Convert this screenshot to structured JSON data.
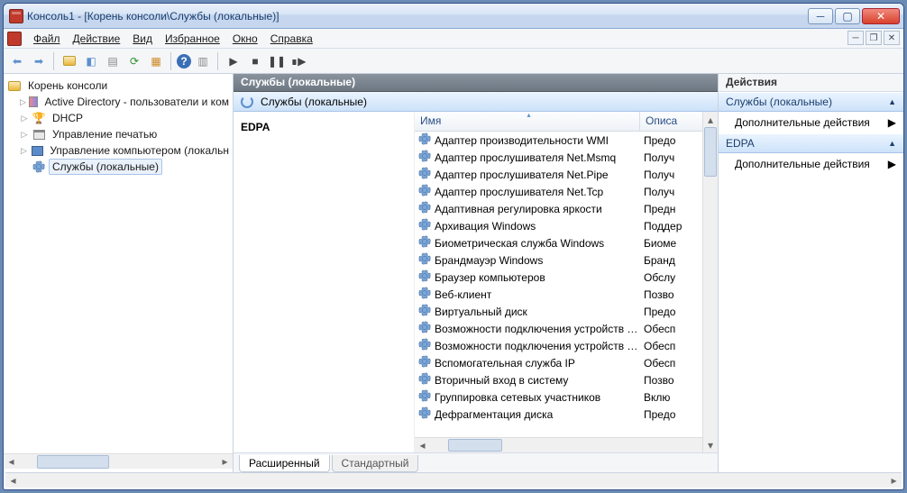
{
  "window": {
    "title": "Консоль1 - [Корень консоли\\Службы (локальные)]"
  },
  "menu": {
    "file": "Файл",
    "action": "Действие",
    "view": "Вид",
    "favorites": "Избранное",
    "window": "Окно",
    "help": "Справка"
  },
  "tree": {
    "root": "Корень консоли",
    "items": [
      "Active Directory - пользователи и ком",
      "DHCP",
      "Управление печатью",
      "Управление компьютером (локальн",
      "Службы (локальные)"
    ]
  },
  "center": {
    "title": "Службы (локальные)",
    "subtitle": "Службы (локальные)",
    "selected_name": "EDPA",
    "col_name": "Имя",
    "col_desc": "Описа"
  },
  "services": [
    {
      "name": "Адаптер производительности WMI",
      "desc": "Предо"
    },
    {
      "name": "Адаптер прослушивателя Net.Msmq",
      "desc": "Получ"
    },
    {
      "name": "Адаптер прослушивателя Net.Pipe",
      "desc": "Получ"
    },
    {
      "name": "Адаптер прослушивателя Net.Tcp",
      "desc": "Получ"
    },
    {
      "name": "Адаптивная регулировка яркости",
      "desc": "Предн"
    },
    {
      "name": "Архивация Windows",
      "desc": "Поддер"
    },
    {
      "name": "Биометрическая служба Windows",
      "desc": "Биоме"
    },
    {
      "name": "Брандмауэр Windows",
      "desc": "Бранд"
    },
    {
      "name": "Браузер компьютеров",
      "desc": "Обслу"
    },
    {
      "name": "Веб-клиент",
      "desc": "Позво"
    },
    {
      "name": "Виртуальный диск",
      "desc": "Предо"
    },
    {
      "name": "Возможности подключения устройств …",
      "desc": "Обесп"
    },
    {
      "name": "Возможности подключения устройств …",
      "desc": "Обесп"
    },
    {
      "name": "Вспомогательная служба IP",
      "desc": "Обесп"
    },
    {
      "name": "Вторичный вход в систему",
      "desc": "Позво"
    },
    {
      "name": "Группировка сетевых участников",
      "desc": "Вклю"
    },
    {
      "name": "Дефрагментация диска",
      "desc": "Предо"
    }
  ],
  "tabs": {
    "extended": "Расширенный",
    "standard": "Стандартный"
  },
  "actions": {
    "header": "Действия",
    "section1": "Службы (локальные)",
    "more1": "Дополнительные действия",
    "section2": "EDPA",
    "more2": "Дополнительные действия"
  }
}
